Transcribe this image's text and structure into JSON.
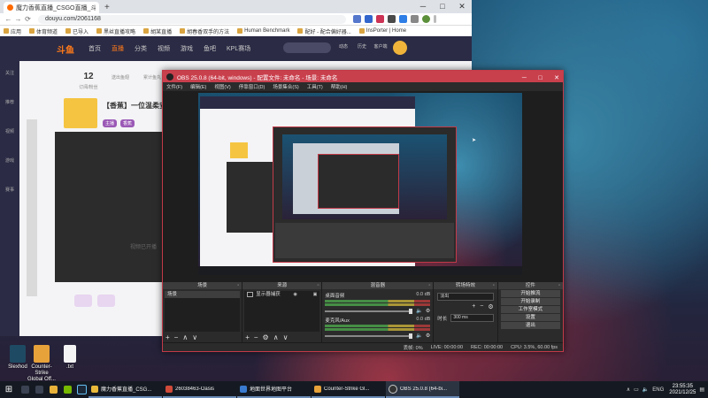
{
  "browser": {
    "tab_title": "魔力香蕉直播_CSGO直播_斗鱼直...",
    "new_tab": "+",
    "url": "douyu.com/2061168",
    "bookmarks": [
      "应用",
      "体育频道",
      "已导入",
      "黑丝直播攻略",
      "胡某直播",
      "胡春香双手的方法",
      "...",
      "Human Benchmark",
      "配好 - 配合偏好器...",
      "...",
      "InsPorter | Home"
    ],
    "win_min": "─",
    "win_max": "□",
    "win_close": "✕"
  },
  "site": {
    "logo": "斗鱼",
    "nav": [
      "首页",
      "直播",
      "分类",
      "视频",
      "游戏",
      "鱼吧",
      "KPL赛场"
    ],
    "nav_active_index": 1,
    "header_icons": [
      "动态",
      "历史",
      "客户端"
    ],
    "sidebar": [
      "关注",
      "推荐",
      "视频",
      "游戏",
      "赛事"
    ],
    "stats": [
      {
        "value": "12",
        "label": "订阅/粉丝"
      },
      {
        "value": "",
        "label": "送出鱼翅"
      },
      {
        "value": "",
        "label": "累计鱼丸"
      }
    ],
    "room_title": "【香蕉】一位温柔安",
    "room_tags": [
      "主播",
      "香蕉"
    ],
    "video_caption": "视频已开播"
  },
  "obs": {
    "title": "OBS 25.0.8 (64-bit, windows) - 配置文件: 未命名 - 场景: 未命名",
    "menu": [
      "文件(F)",
      "编辑(E)",
      "视图(V)",
      "停靠窗口(D)",
      "场景集合(S)",
      "工具(T)",
      "帮助(H)"
    ],
    "docks": {
      "scenes": {
        "header": "场景",
        "items": [
          "场景"
        ]
      },
      "sources": {
        "header": "来源",
        "items": [
          "显示器捕获"
        ]
      },
      "mixer": {
        "header": "混音器",
        "channels": [
          {
            "name": "桌面音频",
            "db": "0.0 dB"
          },
          {
            "name": "麦克风/Aux",
            "db": "0.0 dB"
          }
        ]
      },
      "transitions": {
        "header": "转场特效",
        "type_label": "淡出",
        "duration_label": "时长",
        "duration": "300 ms"
      },
      "controls": {
        "header": "控件",
        "buttons": [
          "开始推流",
          "开始录制",
          "工作室模式",
          "设置",
          "退出"
        ]
      }
    },
    "footer_buttons": [
      "+",
      "−",
      "∧",
      "∨"
    ],
    "status": {
      "live": "LIVE: 00:00:00",
      "rec": "REC: 00:00:00",
      "cpu": "CPU: 3.5%, 60.00 fps",
      "drop": "丢帧: 0%"
    }
  },
  "desktop_icons": [
    {
      "label": "Slexhod"
    },
    {
      "label": "Counter-Strike Global Off..."
    },
    {
      "label": ".txt"
    }
  ],
  "taskbar": {
    "apps": [
      "魔力香蕉直播_CSG...",
      "26038463-Oasis",
      "地面世界地图平台",
      "Counter-Strike Gl...",
      "OBS 25.0.8 (64-bi..."
    ],
    "active_index": 4,
    "lang": "ENG",
    "time": "23:55:35",
    "date": "2021/12/25"
  },
  "colors": {
    "obs_title": "#c9404d",
    "douyu_orange": "#ff7a1a",
    "site_header": "#2b2b45"
  }
}
